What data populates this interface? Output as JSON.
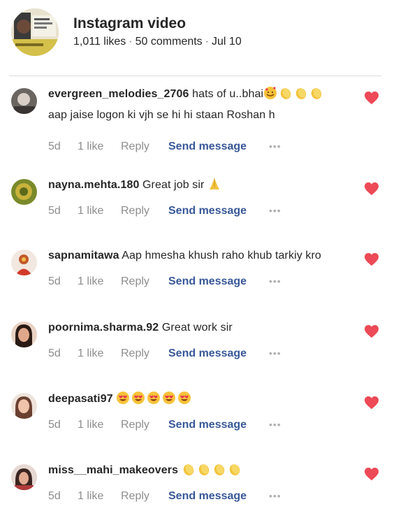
{
  "post": {
    "title": "Instagram video",
    "likes": "1,011 likes",
    "comments_count": "50 comments",
    "date": "Jul 10"
  },
  "colors": {
    "heart": "#ed4956",
    "link": "#385898",
    "muted": "#8e8e8e"
  },
  "comments": [
    {
      "username": "evergreen_melodies_2706",
      "text_before": "hats of u..bhai",
      "emojis": [
        "smiling-face-with-hearts",
        "clapping-hands",
        "clapping-hands",
        "clapping-hands"
      ],
      "text_after": "aap jaise logon ki vjh se hi hi staan Roshan h",
      "time": "5d",
      "likes": "1 like",
      "reply": "Reply",
      "send": "Send message",
      "more": "•••"
    },
    {
      "username": "nayna.mehta.180",
      "text_before": "Great job sir",
      "emojis": [
        "folded-hands"
      ],
      "text_after": "",
      "time": "5d",
      "likes": "1 like",
      "reply": "Reply",
      "send": "Send message",
      "more": "•••"
    },
    {
      "username": "sapnamitawa",
      "text_before": "Aap hmesha khush raho khub tarkiy kro",
      "emojis": [],
      "text_after": "",
      "time": "5d",
      "likes": "1 like",
      "reply": "Reply",
      "send": "Send message",
      "more": "•••"
    },
    {
      "username": "poornima.sharma.92",
      "text_before": "Great work sir",
      "emojis": [],
      "text_after": "",
      "time": "5d",
      "likes": "1 like",
      "reply": "Reply",
      "send": "Send message",
      "more": "•••"
    },
    {
      "username": "deepasati97",
      "text_before": "",
      "emojis": [
        "heart-eyes",
        "heart-eyes",
        "heart-eyes",
        "heart-eyes",
        "heart-eyes"
      ],
      "text_after": "",
      "time": "5d",
      "likes": "1 like",
      "reply": "Reply",
      "send": "Send message",
      "more": "•••"
    },
    {
      "username": "miss__mahi_makeovers",
      "text_before": "",
      "emojis": [
        "clapping-hands",
        "clapping-hands",
        "clapping-hands",
        "clapping-hands"
      ],
      "text_after": "",
      "time": "5d",
      "likes": "1 like",
      "reply": "Reply",
      "send": "Send message",
      "more": "•••"
    }
  ]
}
